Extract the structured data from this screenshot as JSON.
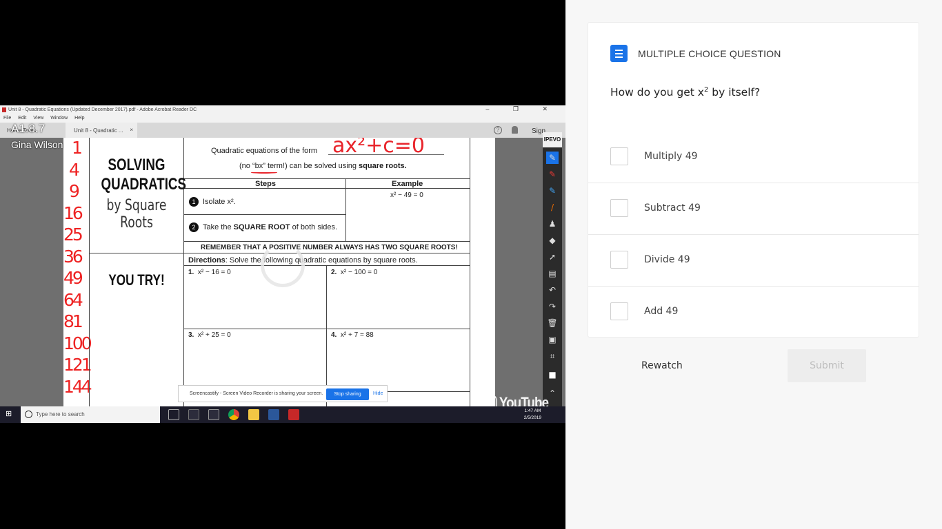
{
  "video": {
    "window_title": "Unit 8 - Quadratic Equations (Updated December 2017).pdf - Adobe Acrobat Reader DC",
    "window_controls": "–   ❐   ✕",
    "menu": [
      "File",
      "Edit",
      "View",
      "Window",
      "Help"
    ],
    "tab_home_tools": "Home   Tools",
    "doc_tab": "Unit 8 - Quadratic ...",
    "doc_tab_close": "×",
    "sign_label": "Sign",
    "overlay_code": "A1.8.7",
    "overlay_author": "Gina Wilson",
    "handwritten_numbers": [
      "1",
      "4",
      "9",
      "16",
      "25",
      "36",
      "49",
      "64",
      "81",
      "100",
      "121",
      "144"
    ],
    "handwritten_form": "ax²+c=0",
    "sheet": {
      "title_line1": "SOLVING",
      "title_line2": "QUADRATICS",
      "subtitle": "by Square Roots",
      "intro_prefix": "Quadratic equations of the form",
      "intro_line2_a": "(no “bx” term!) can be solved using",
      "intro_line2_b": "square roots.",
      "col_steps": "Steps",
      "col_example": "Example",
      "step1_num": "1",
      "step1": "Isolate x².",
      "step2_num": "2",
      "step2_a": "Take the",
      "step2_b": "SQUARE ROOT",
      "step2_c": "of both sides.",
      "example": "x² − 49 = 0",
      "remember": "REMEMBER THAT A POSITIVE NUMBER ALWAYS HAS TWO SQUARE ROOTS!",
      "you_try": "YOU TRY!",
      "directions_label": "Directions",
      "directions": ": Solve the following quadratic equations by square roots.",
      "problems": [
        {
          "n": "1.",
          "eq": "x² − 16 = 0"
        },
        {
          "n": "2.",
          "eq": "x² − 100 = 0"
        },
        {
          "n": "3.",
          "eq": "x² + 25 = 0"
        },
        {
          "n": "4.",
          "eq": "x² + 7 = 88"
        }
      ]
    },
    "toolbar_title": "IPEVO",
    "share_message": "Screencastify - Screen Video Recorder is sharing your screen.",
    "share_stop": "Stop sharing",
    "share_hide": "Hide",
    "youtube_label": "YouTube",
    "taskbar_search": "Type here to search",
    "clock_time": "1:47 AM",
    "clock_date": "2/5/2019"
  },
  "quiz": {
    "type_label": "MULTIPLE CHOICE QUESTION",
    "question_prefix": "How do you get x",
    "question_sup": "2",
    "question_suffix": " by itself?",
    "options": [
      "Multiply 49",
      "Subtract 49",
      "Divide 49",
      "Add 49"
    ],
    "rewatch_label": "Rewatch",
    "submit_label": "Submit",
    "accent_color": "#1a73e8"
  }
}
